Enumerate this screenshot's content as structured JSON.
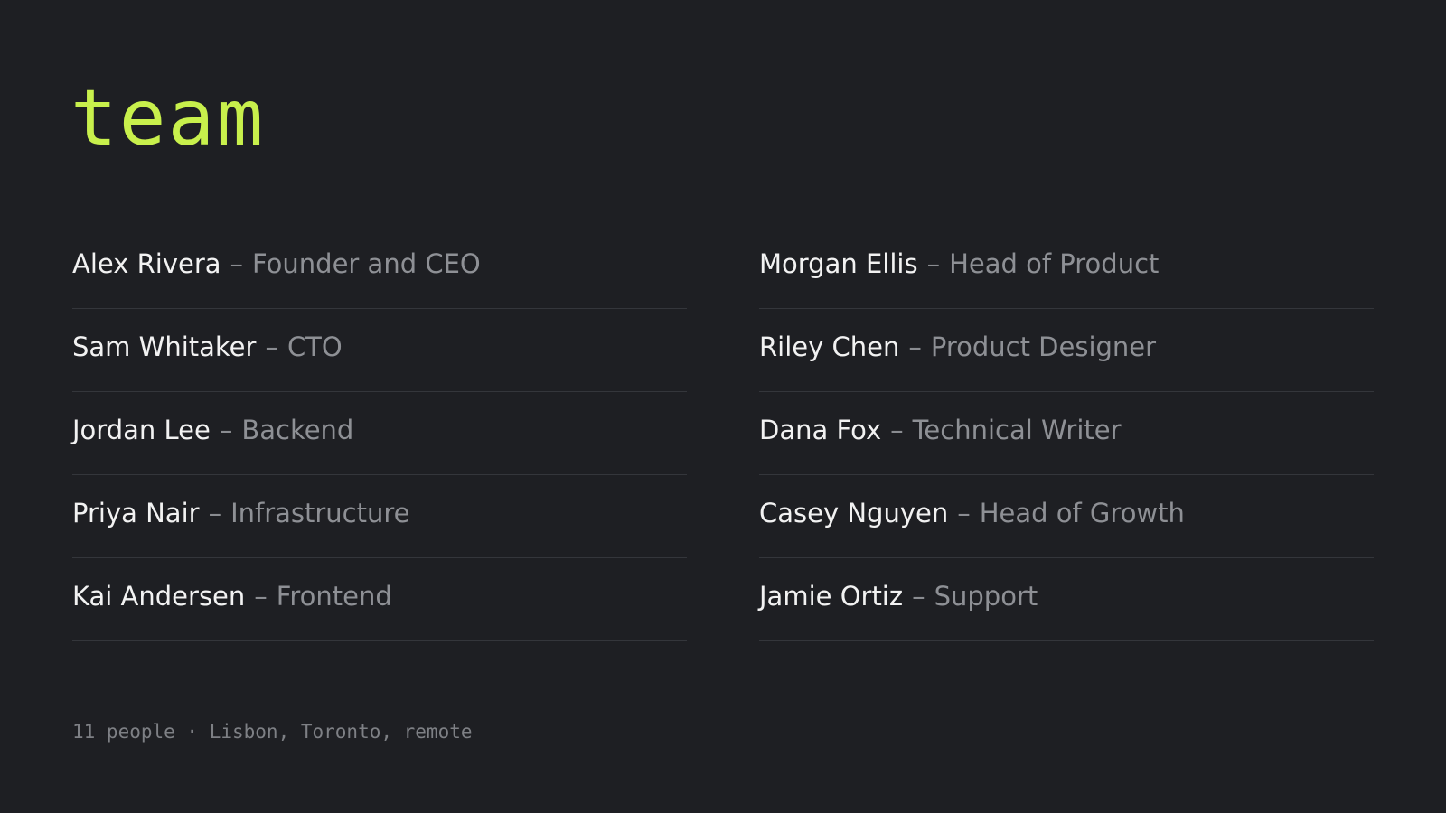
{
  "title": "team",
  "left_column": [
    {
      "name": "Alex Rivera",
      "separator": "–",
      "role": "Founder and CEO"
    },
    {
      "name": "Sam Whitaker",
      "separator": "–",
      "role": "CTO"
    },
    {
      "name": "Jordan Lee",
      "separator": "–",
      "role": "Backend"
    },
    {
      "name": "Priya Nair",
      "separator": "–",
      "role": "Infrastructure"
    },
    {
      "name": "Kai Andersen",
      "separator": "–",
      "role": "Frontend"
    }
  ],
  "right_column": [
    {
      "name": "Morgan Ellis",
      "separator": "–",
      "role": "Head of Product"
    },
    {
      "name": "Riley Chen",
      "separator": "–",
      "role": "Product Designer"
    },
    {
      "name": "Dana Fox",
      "separator": "–",
      "role": "Technical Writer"
    },
    {
      "name": "Casey Nguyen",
      "separator": "–",
      "role": "Head of Growth"
    },
    {
      "name": "Jamie Ortiz",
      "separator": "–",
      "role": "Support"
    }
  ],
  "footer": "11 people · Lisbon, Toronto, remote",
  "colors": {
    "background": "#1e1f23",
    "accent": "#c8f04c",
    "name_text": "#f2f2f2",
    "role_text": "#8e9095",
    "divider": "#34363b"
  }
}
